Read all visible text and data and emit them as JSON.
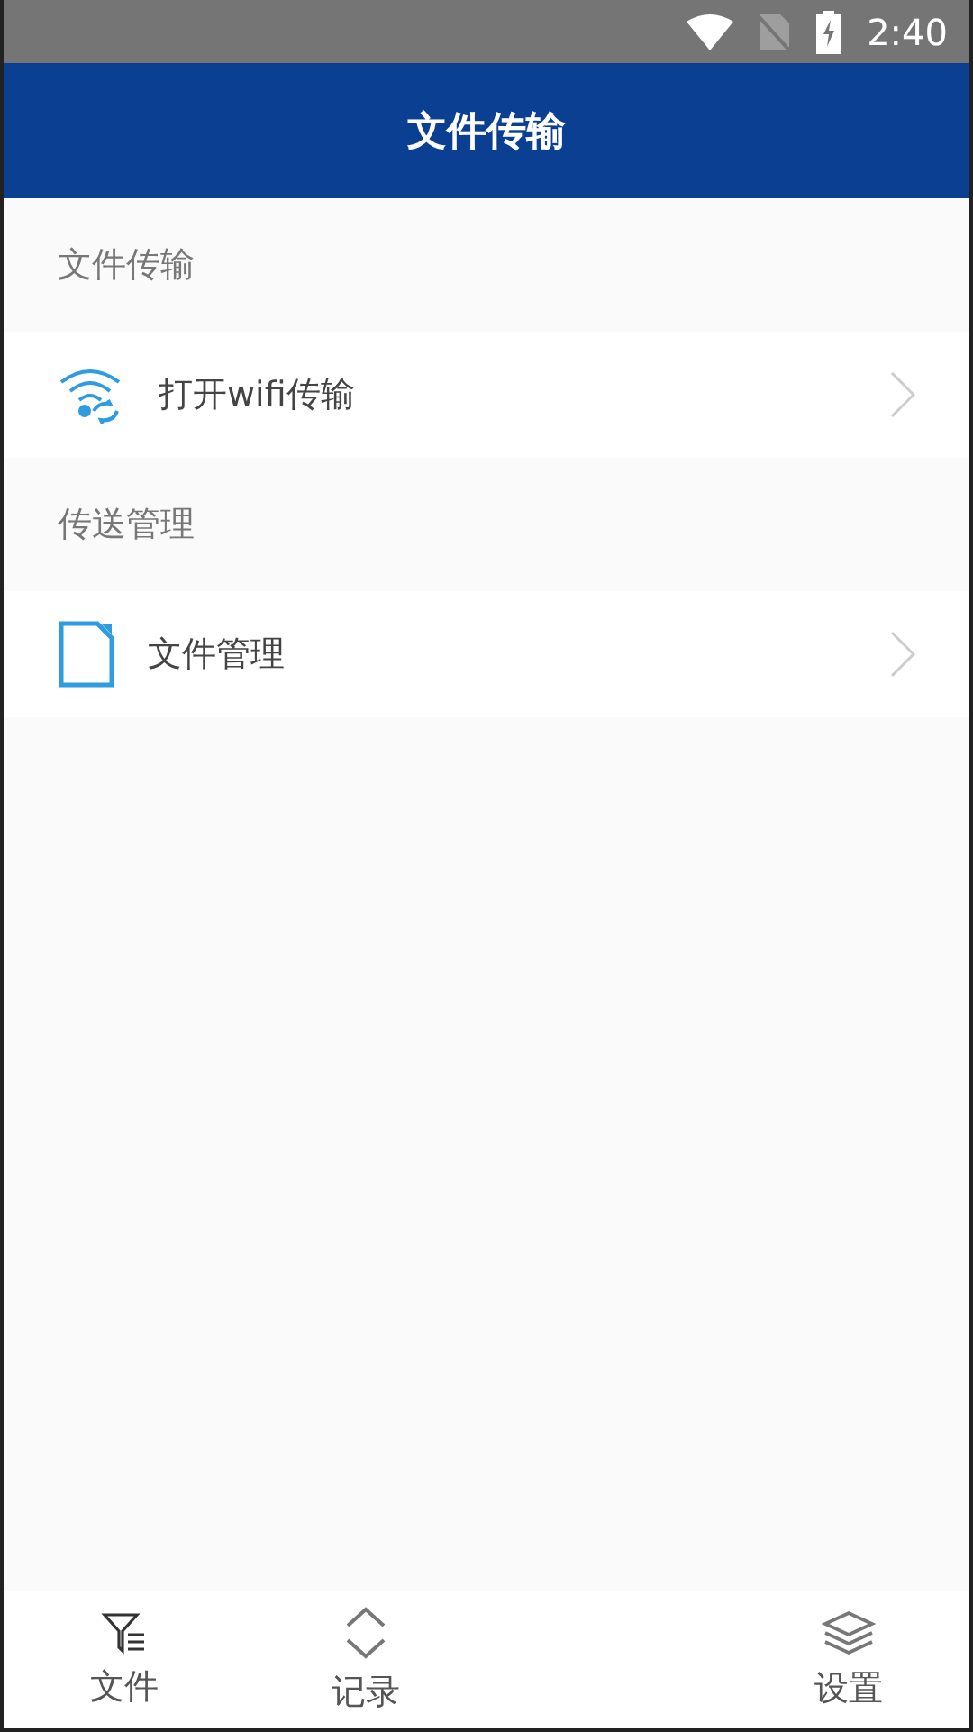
{
  "status_bar": {
    "time": "2:40"
  },
  "header": {
    "title": "文件传输"
  },
  "sections": [
    {
      "title": "文件传输",
      "items": [
        {
          "kind": "wifi",
          "label": "打开wifi传输"
        }
      ]
    },
    {
      "title": "传送管理",
      "items": [
        {
          "kind": "file",
          "label": "文件管理"
        }
      ]
    }
  ],
  "bottom_nav": [
    {
      "kind": "filter",
      "label": "文件"
    },
    {
      "kind": "updown",
      "label": "记录"
    },
    {
      "kind": "layers",
      "label": "设置"
    }
  ]
}
